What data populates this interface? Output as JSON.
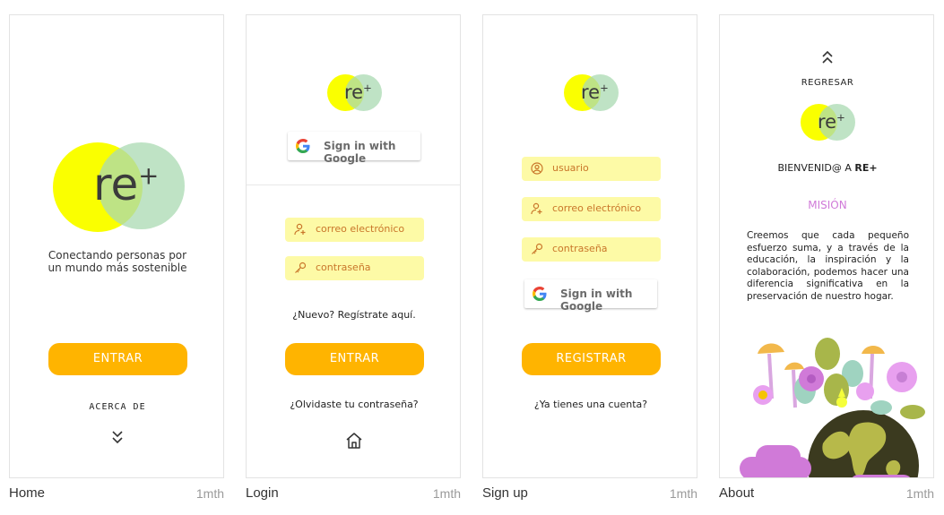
{
  "brand": {
    "logo_text": "re",
    "logo_sup": "+",
    "yellow": "#faff00",
    "green": "#aadab2",
    "orange": "#ffb400",
    "field_bg": "#fdfaa6"
  },
  "screens": {
    "home": {
      "caption": "Home",
      "time": "1mth",
      "tagline_1": "Conectando personas por",
      "tagline_2": "un mundo más sostenible",
      "enter_label": "ENTRAR",
      "about_label": "ACERCA DE"
    },
    "login": {
      "caption": "Login",
      "time": "1mth",
      "google_label": "Sign in with Google",
      "email_placeholder": "correo electrónico",
      "password_placeholder": "contraseña",
      "register_link": "¿Nuevo? Regístrate aquí.",
      "enter_label": "ENTRAR",
      "forgot_link": "¿Olvidaste tu contraseña?"
    },
    "signup": {
      "caption": "Sign up",
      "time": "1mth",
      "user_placeholder": "usuario",
      "email_placeholder": "correo electrónico",
      "password_placeholder": "contraseña",
      "google_label": "Sign in with Google",
      "register_label": "REGISTRAR",
      "have_account_link": "¿Ya tienes una cuenta?"
    },
    "about": {
      "caption": "About",
      "time": "1mth",
      "back_label": "REGRESAR",
      "welcome_prefix": "BIENVENID@ A",
      "welcome_brand": "RE+",
      "mission_title": "MISIÓN",
      "mission_text": "Creemos que cada pequeño esfuerzo suma, y a través de la educación, la inspiración y la colaboración, podemos hacer una diferencia significativa en la preservación de nuestro hogar."
    }
  }
}
